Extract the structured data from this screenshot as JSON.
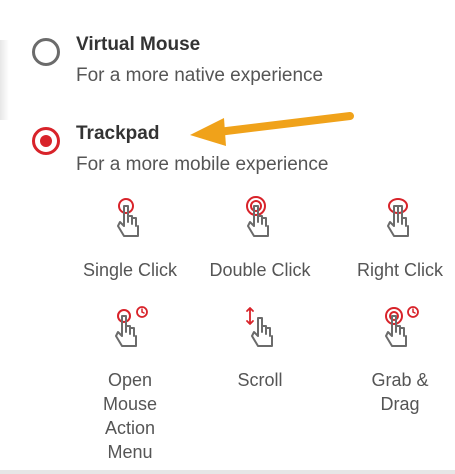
{
  "options": {
    "virtual_mouse": {
      "title": "Virtual Mouse",
      "subtitle": "For a more native experience",
      "selected": false
    },
    "trackpad": {
      "title": "Trackpad",
      "subtitle": "For a more mobile experience",
      "selected": true
    }
  },
  "gestures": [
    {
      "label": "Single Click",
      "icon": "single-tap-hand-icon"
    },
    {
      "label": "Double Click",
      "icon": "double-tap-hand-icon"
    },
    {
      "label": "Right Click",
      "icon": "two-finger-tap-hand-icon"
    },
    {
      "label": "Open Mouse Action Menu",
      "icon": "tap-and-hold-hand-icon"
    },
    {
      "label": "Scroll",
      "icon": "scroll-hand-icon"
    },
    {
      "label": "Grab & Drag",
      "icon": "tap-hold-drag-hand-icon"
    }
  ],
  "colors": {
    "accent": "#d8232a",
    "arrow": "#f0a21a",
    "text": "#555555"
  }
}
